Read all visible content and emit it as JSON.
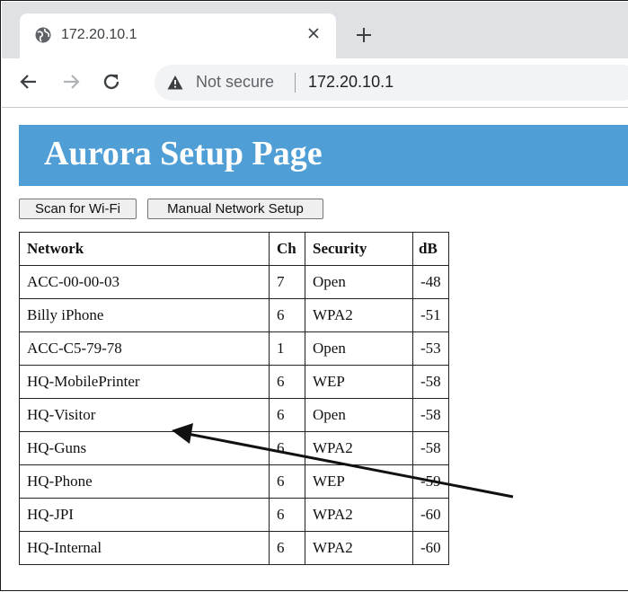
{
  "tab": {
    "title": "172.20.10.1"
  },
  "toolbar": {
    "security_label": "Not secure",
    "url": "172.20.10.1"
  },
  "header": {
    "title": "Aurora Setup Page"
  },
  "buttons": {
    "scan": "Scan for Wi-Fi",
    "manual": "Manual Network Setup"
  },
  "table": {
    "columns": [
      "Network",
      "Ch",
      "Security",
      "dB"
    ],
    "rows": [
      [
        "ACC-00-00-03",
        "7",
        "Open",
        "-48"
      ],
      [
        "Billy iPhone",
        "6",
        "WPA2",
        "-51"
      ],
      [
        "ACC-C5-79-78",
        "1",
        "Open",
        "-53"
      ],
      [
        "HQ-MobilePrinter",
        "6",
        "WEP",
        "-58"
      ],
      [
        "HQ-Visitor",
        "6",
        "Open",
        "-58"
      ],
      [
        "HQ-Guns",
        "6",
        "WPA2",
        "-58"
      ],
      [
        "HQ-Phone",
        "6",
        "WEP",
        "-59"
      ],
      [
        "HQ-JPI",
        "6",
        "WPA2",
        "-60"
      ],
      [
        "HQ-Internal",
        "6",
        "WPA2",
        "-60"
      ]
    ]
  },
  "icons": {
    "favicon": "globe-icon",
    "close": "close-icon",
    "new_tab": "plus-icon",
    "back": "back-arrow-icon",
    "forward": "forward-arrow-icon",
    "reload": "reload-icon",
    "security": "warning-icon"
  }
}
